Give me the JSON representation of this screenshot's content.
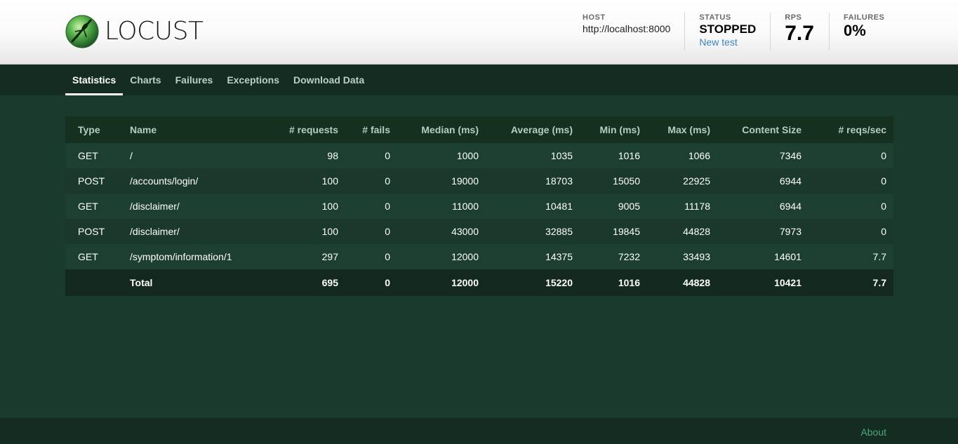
{
  "app": {
    "name": "LOCUST",
    "colors": {
      "header_bg": "#f5f5f5",
      "body_bg": "#1b3a2e",
      "tab_bar": "#142c22",
      "link": "#3c84c4",
      "about_link": "#4ea77a"
    }
  },
  "header": {
    "host_label": "HOST",
    "host_value": "http://localhost:8000",
    "status_label": "STATUS",
    "status_value": "STOPPED",
    "new_test_label": "New test",
    "rps_label": "RPS",
    "rps_value": "7.7",
    "failures_label": "FAILURES",
    "failures_value": "0%"
  },
  "tabs": [
    {
      "label": "Statistics",
      "active": true
    },
    {
      "label": "Charts"
    },
    {
      "label": "Failures"
    },
    {
      "label": "Exceptions"
    },
    {
      "label": "Download Data"
    }
  ],
  "table": {
    "columns": [
      "Type",
      "Name",
      "# requests",
      "# fails",
      "Median (ms)",
      "Average (ms)",
      "Min (ms)",
      "Max (ms)",
      "Content Size",
      "# reqs/sec"
    ],
    "rows": [
      [
        "GET",
        "/",
        "98",
        "0",
        "1000",
        "1035",
        "1016",
        "1066",
        "7346",
        "0"
      ],
      [
        "POST",
        "/accounts/login/",
        "100",
        "0",
        "19000",
        "18703",
        "15050",
        "22925",
        "6944",
        "0"
      ],
      [
        "GET",
        "/disclaimer/",
        "100",
        "0",
        "11000",
        "10481",
        "9005",
        "11178",
        "6944",
        "0"
      ],
      [
        "POST",
        "/disclaimer/",
        "100",
        "0",
        "43000",
        "32885",
        "19845",
        "44828",
        "7973",
        "0"
      ],
      [
        "GET",
        "/symptom/information/1",
        "297",
        "0",
        "12000",
        "14375",
        "7232",
        "33493",
        "14601",
        "7.7"
      ]
    ],
    "total": [
      "",
      "Total",
      "695",
      "0",
      "12000",
      "15220",
      "1016",
      "44828",
      "10421",
      "7.7"
    ]
  },
  "footer": {
    "about_label": "About"
  },
  "icons": {
    "logo": "locust-logo-icon"
  }
}
